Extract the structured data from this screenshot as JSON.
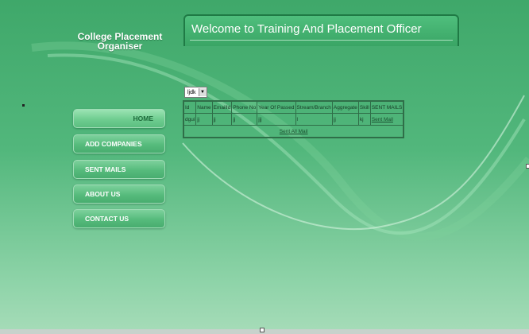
{
  "brand": {
    "line1": "College Placement",
    "line2": "Organiser"
  },
  "header": {
    "title": "Welcome to Training And Placement Officer"
  },
  "nav": [
    {
      "label": "HOME"
    },
    {
      "label": "ADD COMPANIES"
    },
    {
      "label": "SENT MAILS"
    },
    {
      "label": "ABOUT US"
    },
    {
      "label": "CONTACT US"
    }
  ],
  "filter": {
    "selected": "ljdk"
  },
  "table": {
    "headers": [
      "Id",
      "Name",
      "EmailId",
      "Phone No",
      "Year Of Passed",
      "Stream/Branch",
      "Aggregate",
      "Skill",
      "SENT MAILS"
    ],
    "rows": [
      [
        "dgui",
        "jj",
        "jj",
        "jj",
        "jjj",
        "l",
        "jj",
        "kj",
        "Sent Mail"
      ]
    ],
    "footer_link": "Sent All Mail"
  }
}
